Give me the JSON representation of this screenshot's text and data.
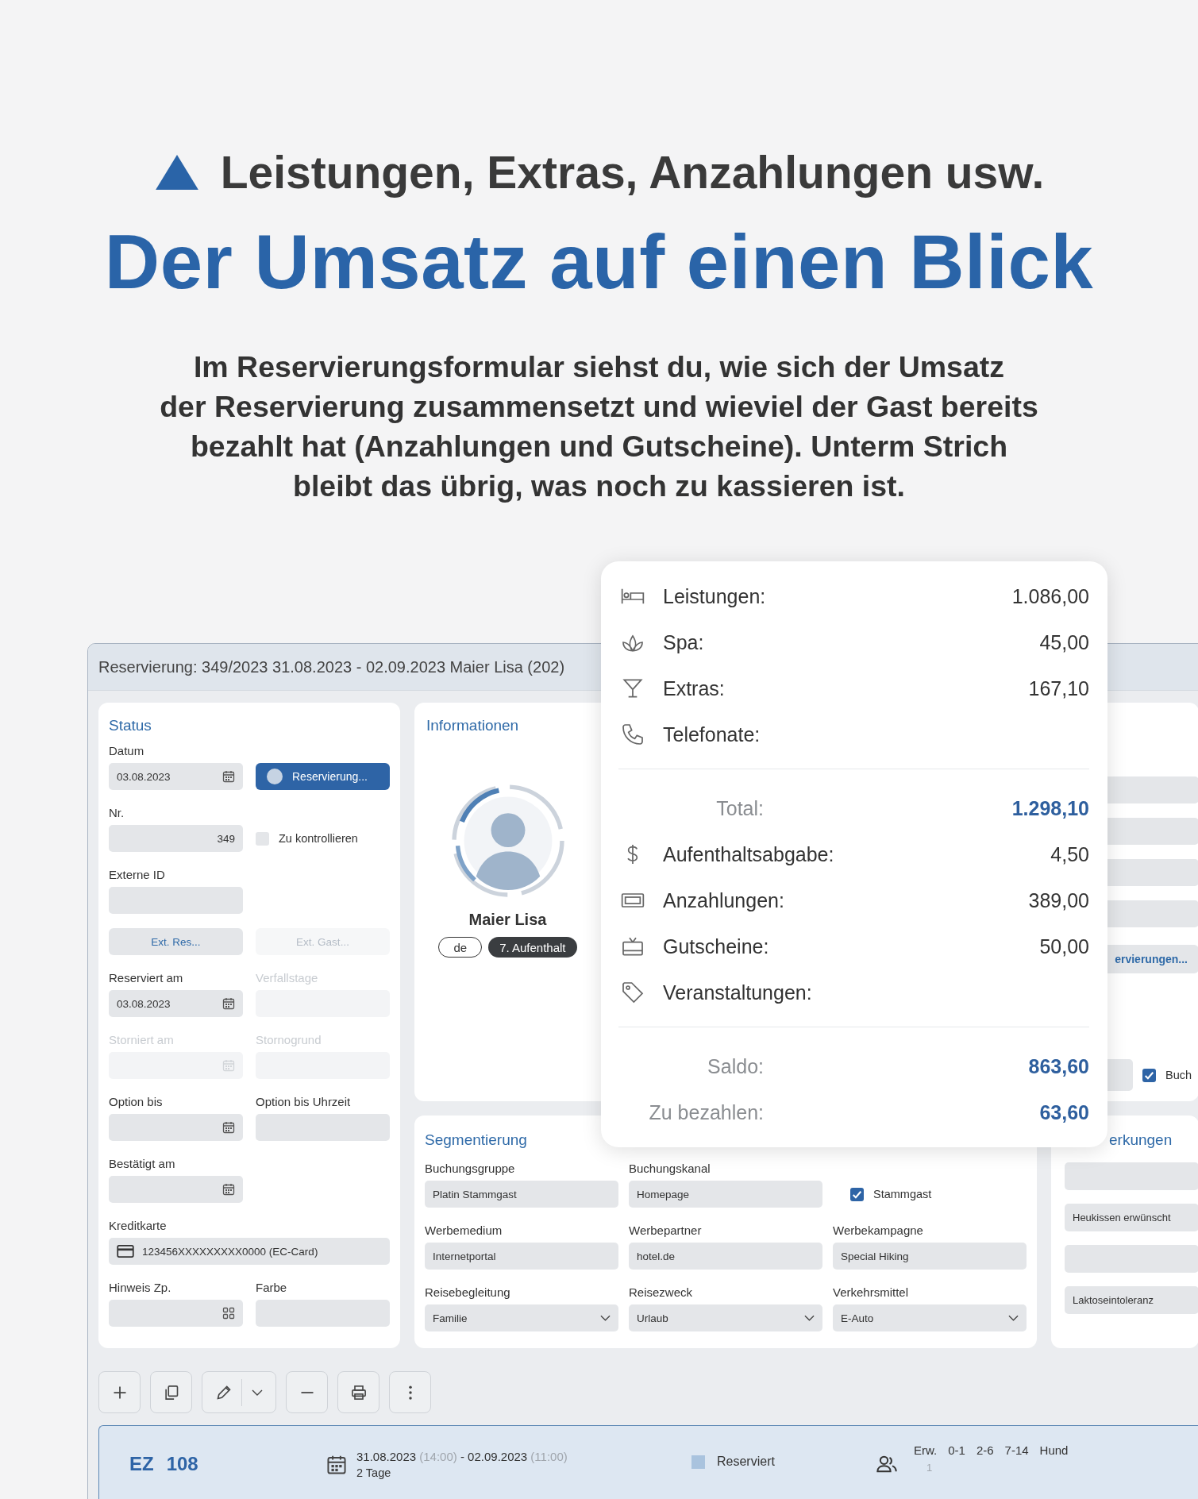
{
  "header": {
    "kicker": "Leistungen, Extras, Anzahlungen usw.",
    "title": "Der Umsatz auf einen Blick",
    "lines": [
      "Im Reservierungsformular siehst du, wie sich der Umsatz",
      "der Reservierung zusammensetzt und wieviel der Gast bereits",
      "bezahlt hat (Anzahlungen und Gutscheine). Unterm Strich",
      "bleibt das übrig, was noch zu kassieren ist."
    ]
  },
  "window": {
    "title": "Reservierung: 349/2023 31.08.2023 - 02.09.2023 Maier Lisa (202)"
  },
  "status": {
    "title": "Status",
    "rows": [
      {
        "cells": [
          {
            "kind": "date",
            "label": "Datum",
            "value": "03.08.2023",
            "disabled": false
          },
          {
            "kind": "state",
            "label": "Reservierung..."
          }
        ]
      },
      {
        "cells": [
          {
            "kind": "number",
            "label": "Nr.",
            "value": "349",
            "disabled": false
          },
          {
            "kind": "checkbox",
            "label": "Zu kontrollieren",
            "checked": false
          }
        ]
      },
      {
        "cells": [
          {
            "kind": "text",
            "label": "Externe ID",
            "disabled": false
          }
        ]
      },
      {
        "cells": [
          {
            "kind": "button",
            "label": "Ext. Res...",
            "disabled": false
          },
          {
            "kind": "button",
            "label": "Ext. Gast...",
            "disabled": true
          }
        ]
      },
      {
        "cells": [
          {
            "kind": "date",
            "label": "Reserviert am",
            "value": "03.08.2023",
            "disabled": false
          },
          {
            "kind": "text",
            "label": "Verfallstage",
            "disabled": true
          }
        ]
      },
      {
        "cells": [
          {
            "kind": "date",
            "label": "Storniert am",
            "disabled": true
          },
          {
            "kind": "text",
            "label": "Stornogrund",
            "disabled": true
          }
        ]
      },
      {
        "cells": [
          {
            "kind": "date",
            "label": "Option bis",
            "disabled": false
          },
          {
            "kind": "text",
            "label": "Option bis Uhrzeit",
            "disabled": false
          }
        ]
      },
      {
        "cells": [
          {
            "kind": "date",
            "label": "Bestätigt am",
            "disabled": false
          }
        ]
      },
      {
        "cells": [
          {
            "kind": "card",
            "label": "Kreditkarte",
            "value": "123456XXXXXXXXX0000 (EC-Card)",
            "disabled": false
          }
        ]
      },
      {
        "cells": [
          {
            "kind": "grid",
            "label": "Hinweis Zp.",
            "disabled": false
          },
          {
            "kind": "text",
            "label": "Farbe",
            "disabled": false
          }
        ]
      }
    ]
  },
  "guest": {
    "title": "Informationen",
    "name": "Maier Lisa",
    "tags": [
      {
        "kind": "outline",
        "text": "de"
      },
      {
        "kind": "filled",
        "text": "7. Aufenthalt"
      }
    ]
  },
  "side_panel": {
    "rows": [
      {
        "kind": "field"
      },
      {
        "kind": "field"
      },
      {
        "kind": "field"
      },
      {
        "kind": "field"
      },
      {
        "kind": "button",
        "label": "ervierungen..."
      },
      {
        "kind": "field_checkbox",
        "label": "Buch",
        "checked": true
      }
    ]
  },
  "segmentation": {
    "title": "Segmentierung",
    "rows": [
      {
        "cells": [
          {
            "kind": "text",
            "label": "Buchungsgruppe",
            "value": "Platin Stammgast"
          },
          {
            "kind": "text",
            "label": "Buchungskanal",
            "value": "Homepage"
          },
          {
            "kind": "checkbox",
            "label": "Stammgast",
            "checked": true
          }
        ]
      },
      {
        "cells": [
          {
            "kind": "text",
            "label": "Werbemedium",
            "value": "Internetportal"
          },
          {
            "kind": "text",
            "label": "Werbepartner",
            "value": "hotel.de"
          },
          {
            "kind": "text",
            "label": "Werbekampagne",
            "value": "Special Hiking"
          }
        ]
      },
      {
        "cells": [
          {
            "kind": "select",
            "label": "Reisebegleitung",
            "value": "Familie"
          },
          {
            "kind": "select",
            "label": "Reisezweck",
            "value": "Urlaub"
          },
          {
            "kind": "select",
            "label": "Verkehrsmittel",
            "value": "E-Auto"
          }
        ]
      }
    ]
  },
  "notes": {
    "title": "erkungen",
    "items": [
      {
        "kind": "empty"
      },
      {
        "kind": "note",
        "value": "Heukissen erwünscht"
      },
      {
        "kind": "empty"
      },
      {
        "kind": "note",
        "value": "Laktoseintoleranz"
      }
    ]
  },
  "summary": {
    "sections": [
      {
        "rows": [
          {
            "kind": "item",
            "label": "Leistungen:",
            "value": "1.086,00"
          },
          {
            "kind": "item",
            "label": "Spa:",
            "value": "45,00"
          },
          {
            "kind": "item",
            "label": "Extras:",
            "value": "167,10"
          },
          {
            "kind": "item",
            "label": "Telefonate:"
          }
        ]
      },
      {
        "rows": [
          {
            "kind": "total",
            "label": "Total:",
            "value": "1.298,10"
          },
          {
            "kind": "item",
            "label": "Aufenthaltsabgabe:",
            "value": "4,50"
          },
          {
            "kind": "item",
            "label": "Anzahlungen:",
            "value": "389,00"
          },
          {
            "kind": "item",
            "label": "Gutscheine:",
            "value": "50,00"
          },
          {
            "kind": "item",
            "label": "Veranstaltungen:"
          }
        ]
      },
      {
        "rows": [
          {
            "kind": "total",
            "label": "Saldo:",
            "value": "863,60"
          },
          {
            "kind": "total",
            "label": "Zu bezahlen:",
            "value": "63,60"
          }
        ]
      }
    ]
  },
  "booking": {
    "category": "EZ",
    "room": "108",
    "dates": [
      {
        "text": "31.08.2023",
        "muted": false
      },
      {
        "text": "(14:00)",
        "muted": true
      },
      {
        "text": "-",
        "muted": false
      },
      {
        "text": "02.09.2023",
        "muted": false
      },
      {
        "text": "(11:00)",
        "muted": true
      }
    ],
    "duration": "2 Tage",
    "status": {
      "label": "Reserviert",
      "color": "#a9c3de"
    },
    "guests": [
      {
        "label": "Erw.",
        "count": "1"
      },
      {
        "label": "0-1"
      },
      {
        "label": "2-6"
      },
      {
        "label": "7-14"
      },
      {
        "label": "Hund"
      }
    ]
  }
}
